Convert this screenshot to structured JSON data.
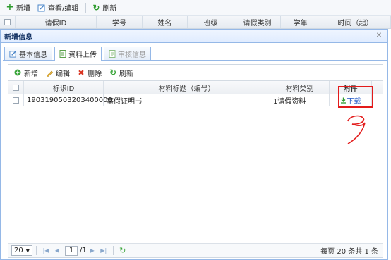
{
  "background": {
    "toolbar": {
      "add": "新增",
      "view_edit": "查看/编辑",
      "refresh": "刷新"
    },
    "columns": [
      "请假ID",
      "学号",
      "姓名",
      "班级",
      "请假类别",
      "学年",
      "时间（起）"
    ]
  },
  "dialog": {
    "title": "新增信息",
    "tabs": [
      "基本信息",
      "资料上传",
      "审核信息"
    ],
    "toolbar": {
      "add": "新增",
      "edit": "编辑",
      "delete": "删除",
      "refresh": "刷新"
    },
    "columns": [
      "标识ID",
      "材料标题（编号）",
      "材料类别",
      "附件"
    ],
    "rows": [
      {
        "id": "1903190503203400000",
        "title": "事假证明书",
        "category": "1请假资料",
        "attachment": "下载"
      }
    ],
    "pager": {
      "page_size": "20",
      "page": "1",
      "total_pages": "/1",
      "info": "每页 20 条共 1 条"
    }
  },
  "colors": {
    "accent": "#95b8e7",
    "annotation": "#e31b1b",
    "link": "#1a53c5"
  }
}
